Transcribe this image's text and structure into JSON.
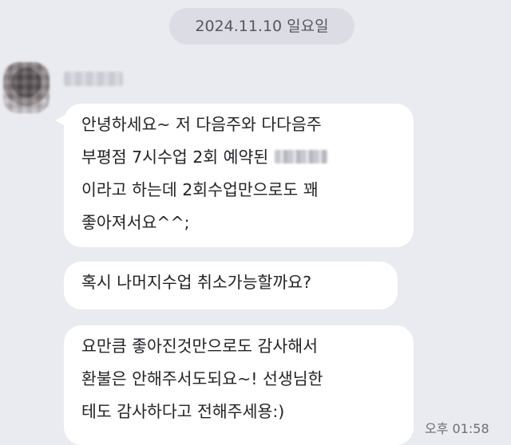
{
  "date_divider": "2024.11.10 일요일",
  "sender": {
    "avatar": "avatar-image",
    "name": ""
  },
  "messages": [
    {
      "lines": [
        "안녕하세요~ 저 다음주와 다다음주",
        "부평점 7시수업 2회 예약된",
        "이라고 하는데 2회수업만으로도 꽤",
        "좋아져서요^^;"
      ]
    },
    {
      "lines": [
        "혹시 나머지수업 취소가능할까요?"
      ]
    },
    {
      "lines": [
        "요만큼 좋아진것만으로도 감사해서",
        "환불은 안해주서도되요~! 선생님한",
        "테도 감사하다고 전해주세용:)"
      ]
    }
  ],
  "timestamp": "오후 01:58",
  "colors": {
    "background": "#eaebf0",
    "bubble": "#ffffff",
    "date_pill": "#dcdde4",
    "text": "#222326"
  }
}
